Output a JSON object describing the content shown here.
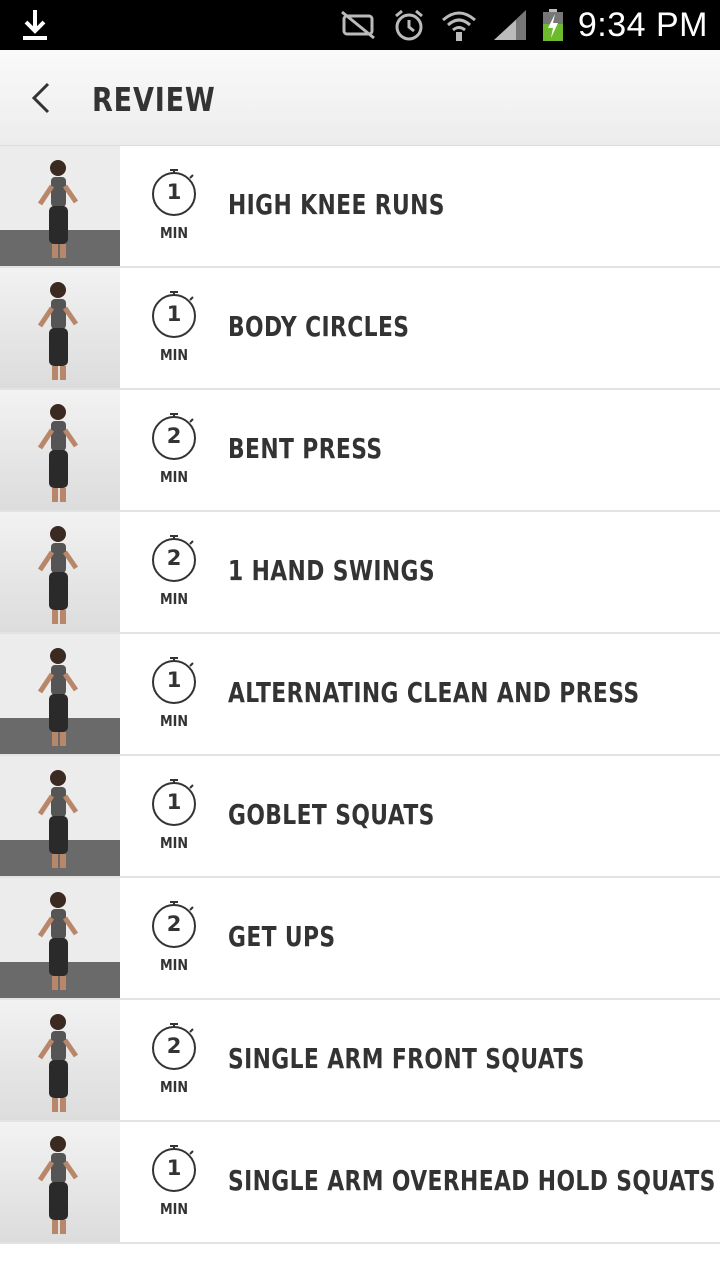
{
  "status_bar": {
    "time": "9:34 PM",
    "icons": [
      "download-icon",
      "mute-icon",
      "alarm-icon",
      "wifi-icon",
      "signal-icon",
      "battery-charging-icon"
    ]
  },
  "header": {
    "title": "REVIEW",
    "back_icon": "back-chevron-icon"
  },
  "exercises": [
    {
      "minutes": "1",
      "unit": "MIN",
      "name": "HIGH KNEE RUNS",
      "thumb": "dark"
    },
    {
      "minutes": "1",
      "unit": "MIN",
      "name": "BODY CIRCLES",
      "thumb": "light"
    },
    {
      "minutes": "2",
      "unit": "MIN",
      "name": "BENT PRESS",
      "thumb": "light"
    },
    {
      "minutes": "2",
      "unit": "MIN",
      "name": "1 HAND SWINGS",
      "thumb": "light"
    },
    {
      "minutes": "1",
      "unit": "MIN",
      "name": "ALTERNATING CLEAN AND PRESS",
      "thumb": "dark"
    },
    {
      "minutes": "1",
      "unit": "MIN",
      "name": "GOBLET SQUATS",
      "thumb": "dark"
    },
    {
      "minutes": "2",
      "unit": "MIN",
      "name": "GET UPS",
      "thumb": "dark"
    },
    {
      "minutes": "2",
      "unit": "MIN",
      "name": "SINGLE ARM FRONT SQUATS",
      "thumb": "light"
    },
    {
      "minutes": "1",
      "unit": "MIN",
      "name": "SINGLE ARM OVERHEAD HOLD SQUATS",
      "thumb": "light"
    }
  ]
}
